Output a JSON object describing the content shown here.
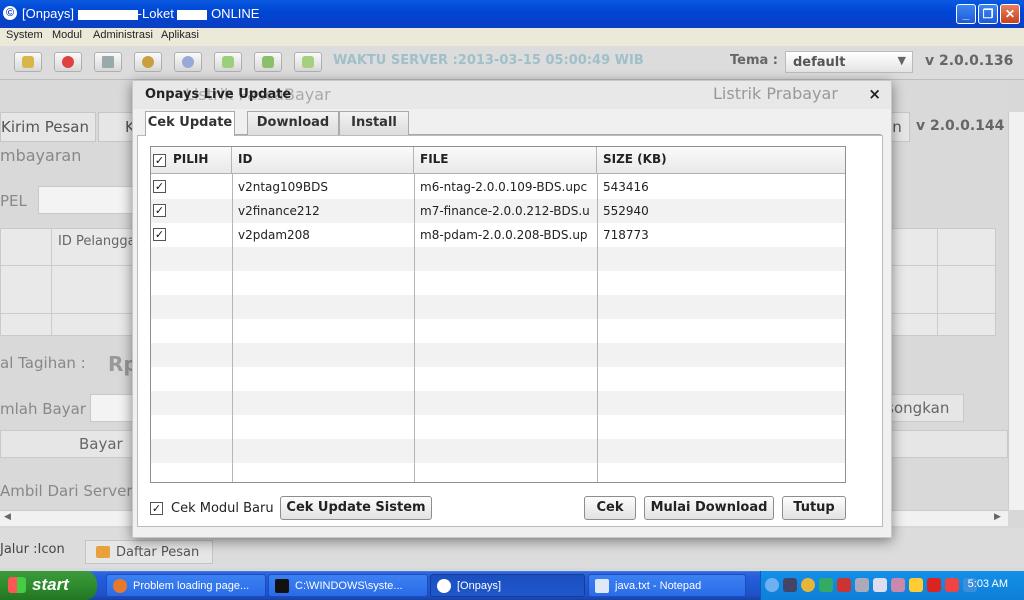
{
  "window": {
    "title_prefix": "[Onpays]",
    "title_middle": "Loket",
    "title_suffix": "ONLINE"
  },
  "menu": [
    "System",
    "Modul",
    "Administrasi",
    "Aplikasi"
  ],
  "toolbar": {
    "waktu_server": "WAKTU SERVER :2013-03-15 05:00:49 WIB",
    "tema_label": "Tema :",
    "tema_value": "default",
    "version": "v 2.0.0.136"
  },
  "background": {
    "header_left": "Listrik PascaBayar",
    "header_right": "Listrik Prabayar",
    "tab_kirim_pesan": "Kirim Pesan",
    "tab_k": "K",
    "tab_an": "an",
    "version2": "v 2.0.0.144",
    "pembayaran": "mbayaran",
    "pel": "PEL",
    "id_pelanggan": "ID Pelangga",
    "total_tagihan": "al Tagihan :",
    "rp": "Rp",
    "jumlah_bayar": "mlah Bayar",
    "kosongkan": "osongkan",
    "bayar": "Bayar",
    "ambil_dari_server": "Ambil Dari Server"
  },
  "status": {
    "jalur": "Jalur :Icon",
    "daftar_pesan": "Daftar Pesan"
  },
  "dialog": {
    "title": "Onpays Live Update",
    "close": "×",
    "tabs": [
      "Cek Update",
      "Download",
      "Install"
    ],
    "columns": [
      "PILIH",
      "ID",
      "FILE",
      "SIZE (KB)"
    ],
    "rows": [
      {
        "checked": true,
        "id": "v2ntag109BDS",
        "file": "m6-ntag-2.0.0.109-BDS.upc",
        "size": "543416"
      },
      {
        "checked": true,
        "id": "v2finance212",
        "file": "m7-finance-2.0.0.212-BDS.u",
        "size": "552940"
      },
      {
        "checked": true,
        "id": "v2pdam208",
        "file": "m8-pdam-2.0.0.208-BDS.up",
        "size": "718773"
      }
    ],
    "cek_modul_baru": "Cek Modul Baru",
    "buttons": {
      "cek_update_sistem": "Cek Update Sistem",
      "cek": "Cek",
      "mulai_download": "Mulai Download",
      "tutup": "Tutup"
    }
  },
  "taskbar": {
    "start": "start",
    "tasks": [
      "Problem loading page...",
      "C:\\WINDOWS\\syste...",
      "[Onpays]",
      "java.txt - Notepad"
    ],
    "clock": "5:03 AM"
  }
}
